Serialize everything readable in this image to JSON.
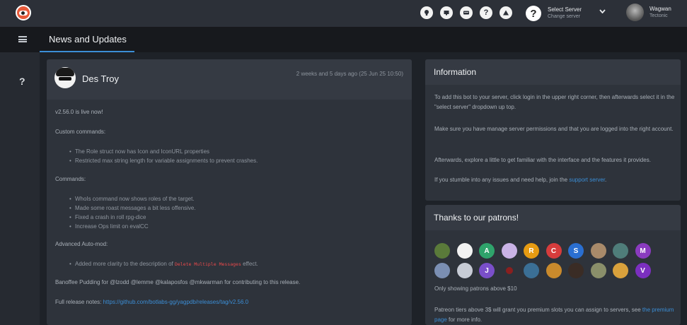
{
  "topbar": {
    "icons": [
      "bulb-icon",
      "monitor-icon",
      "card-icon",
      "?",
      "warning-icon"
    ],
    "server_select": {
      "title": "Select Server",
      "subtitle": "Change server",
      "help_glyph": "?"
    },
    "user": {
      "name": "Wagwan",
      "subtitle": "Tectonic"
    }
  },
  "subbar": {
    "page_title": "News and Updates"
  },
  "sidebar": {
    "help_glyph": "?"
  },
  "post": {
    "author": "Des Troy",
    "time": "2 weeks and 5 days ago (25 Jun 25 10:50)",
    "intro": "v2.56.0 is live now!",
    "sections": [
      {
        "heading": "Custom commands:",
        "items": [
          "The Role struct now has Icon and IconURL properties",
          "Restricted max string length for variable assignments to prevent crashes."
        ]
      },
      {
        "heading": "Commands:",
        "items": [
          "WhoIs command now shows roles of the target.",
          "Made some roast messages a bit less offensive.",
          "Fixed a crash in roll rpg-dice",
          "Increase Ops limit on evalCC"
        ]
      },
      {
        "heading": "Advanced Auto-mod:",
        "items": [
          {
            "before": "Added more clarity to the description of ",
            "code": "Delete Multiple Messages",
            "after": " effect."
          }
        ]
      }
    ],
    "credits": "Banoffee Pudding for @lzodd @lemme @kalaposfos @mkwarman for contributing to this release.",
    "release_label": "Full release notes: ",
    "release_link": "https://github.com/botlabs-gg/yagpdb/releases/tag/v2.56.0"
  },
  "information": {
    "title": "Information",
    "paragraphs": [
      "To add this bot to your server, click login in the upper right corner, then afterwards select it in the \"select server\" dropdown up top.",
      "Make sure you have manage server permissions and that you are logged into the right account.",
      "Afterwards, explore a little to get familiar with the interface and the features it provides."
    ],
    "help_before": "If you stumble into any issues and need help, join the ",
    "help_link": "support server",
    "help_after": "."
  },
  "patrons": {
    "title": "Thanks to our patrons!",
    "row1": [
      {
        "label": "",
        "color": "#5a7a3a"
      },
      {
        "label": "",
        "color": "#f2f2f2"
      },
      {
        "label": "A",
        "color": "#2fa36b"
      },
      {
        "label": "",
        "color": "#c9b3e6"
      },
      {
        "label": "R",
        "color": "#e69b12"
      },
      {
        "label": "C",
        "color": "#d63c3c"
      },
      {
        "label": "S",
        "color": "#2a6fd1"
      },
      {
        "label": "",
        "color": "#a88a6a"
      },
      {
        "label": "",
        "color": "#4f7d7a"
      },
      {
        "label": "M",
        "color": "#8a3bbf"
      }
    ],
    "row2": [
      {
        "label": "",
        "color": "#7b8fb3"
      },
      {
        "label": "",
        "color": "#c7ccd6"
      },
      {
        "label": "J",
        "color": "#7a4fc9"
      },
      {
        "label": "",
        "color": "#8a1f1f"
      },
      {
        "label": "",
        "color": "#3b6f95"
      },
      {
        "label": "",
        "color": "#c98a2c"
      },
      {
        "label": "",
        "color": "#3a2c25"
      },
      {
        "label": "",
        "color": "#8a8f6a"
      },
      {
        "label": "",
        "color": "#d9a13c"
      },
      {
        "label": "V",
        "color": "#7b2fbf"
      }
    ],
    "note": "Only showing patrons above $10",
    "tiers_before": "Patreon tiers above 3$ will grant you premium slots you can assign to servers, see ",
    "tiers_link": "the premium page",
    "tiers_after": " for more info."
  }
}
